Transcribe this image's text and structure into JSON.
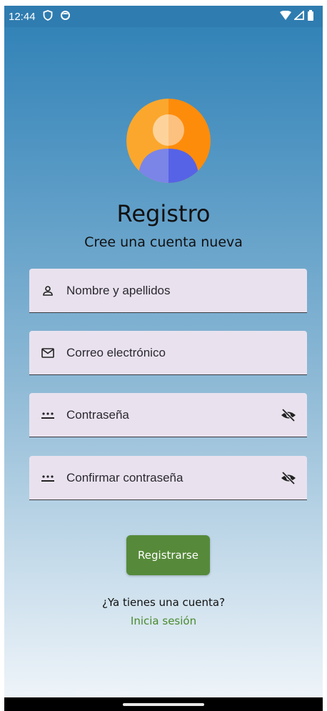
{
  "status": {
    "time": "12:44"
  },
  "header": {
    "title": "Registro",
    "subtitle": "Cree una cuenta nueva"
  },
  "fields": [
    {
      "label": "Nombre y apellidos",
      "icon": "person-icon"
    },
    {
      "label": "Correo electrónico",
      "icon": "mail-icon"
    },
    {
      "label": "Contraseña",
      "icon": "password-icon",
      "trailing_icon": "visibility-off-icon"
    },
    {
      "label": "Confirmar contraseña",
      "icon": "password-icon",
      "trailing_icon": "visibility-off-icon"
    }
  ],
  "actions": {
    "register_label": "Registrarse",
    "have_account_text": "¿Ya tienes una cuenta?",
    "login_link": "Inicia sesión"
  },
  "colors": {
    "accent": "#568a3a",
    "link": "#4a8a2e",
    "field_bg": "#e9e2ee"
  }
}
